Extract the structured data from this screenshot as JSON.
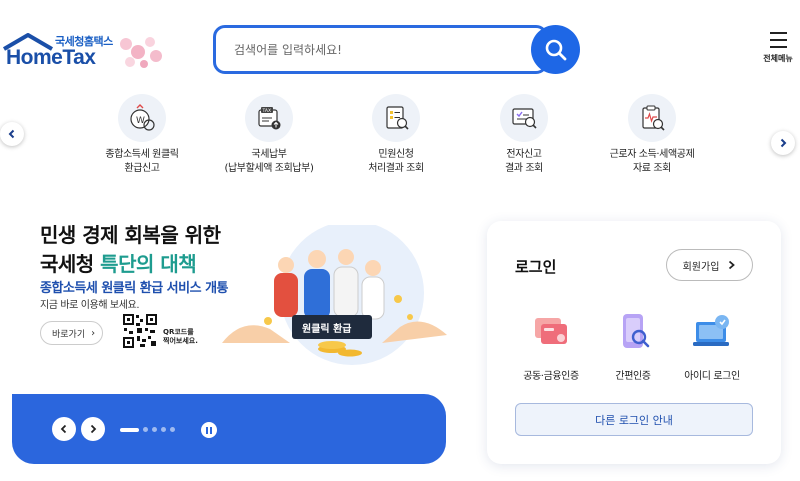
{
  "header": {
    "logo_sub": "국세청홈택스",
    "logo_main": "HomeTax",
    "search_placeholder": "검색어를 입력하세요!",
    "menu_label": "전체메뉴"
  },
  "quick_menu": [
    {
      "label": "종합소득세 원클릭\n환급신고",
      "icon": "refund-report-icon"
    },
    {
      "label": "국세납부\n(납부할세액 조회납부)",
      "icon": "tax-payment-icon"
    },
    {
      "label": "민원신청\n처리결과 조회",
      "icon": "civil-request-icon"
    },
    {
      "label": "전자신고\n결과 조회",
      "icon": "e-filing-result-icon"
    },
    {
      "label": "근로자 소득·세액공제\n자료 조회",
      "icon": "deduction-data-icon"
    }
  ],
  "banner": {
    "line1": "민생 경제 회복을 위한",
    "line2_prefix": "국세청 ",
    "line2_highlight": "특단의 대책",
    "line3": "종합소득세 원클릭 환급 서비스 개통",
    "line4": "지금 바로 이용해 보세요.",
    "go_label": "바로가기",
    "qr_label": "QR코드를\n찍어보세요.",
    "sign_label": "원클릭 환급"
  },
  "slider": {
    "dot_count": 5,
    "active_dot": 1
  },
  "login": {
    "title": "로그인",
    "join_label": "회원가입",
    "options": [
      {
        "label": "공동·금융인증",
        "icon": "certificate-icon"
      },
      {
        "label": "간편인증",
        "icon": "simple-auth-icon"
      },
      {
        "label": "아이디 로그인",
        "icon": "id-login-icon"
      }
    ],
    "other_login": "다른 로그인 안내"
  },
  "colors": {
    "brand_blue": "#1e67e6",
    "banner_blue": "#2b66dd",
    "highlight_teal": "#1e9c8f"
  }
}
